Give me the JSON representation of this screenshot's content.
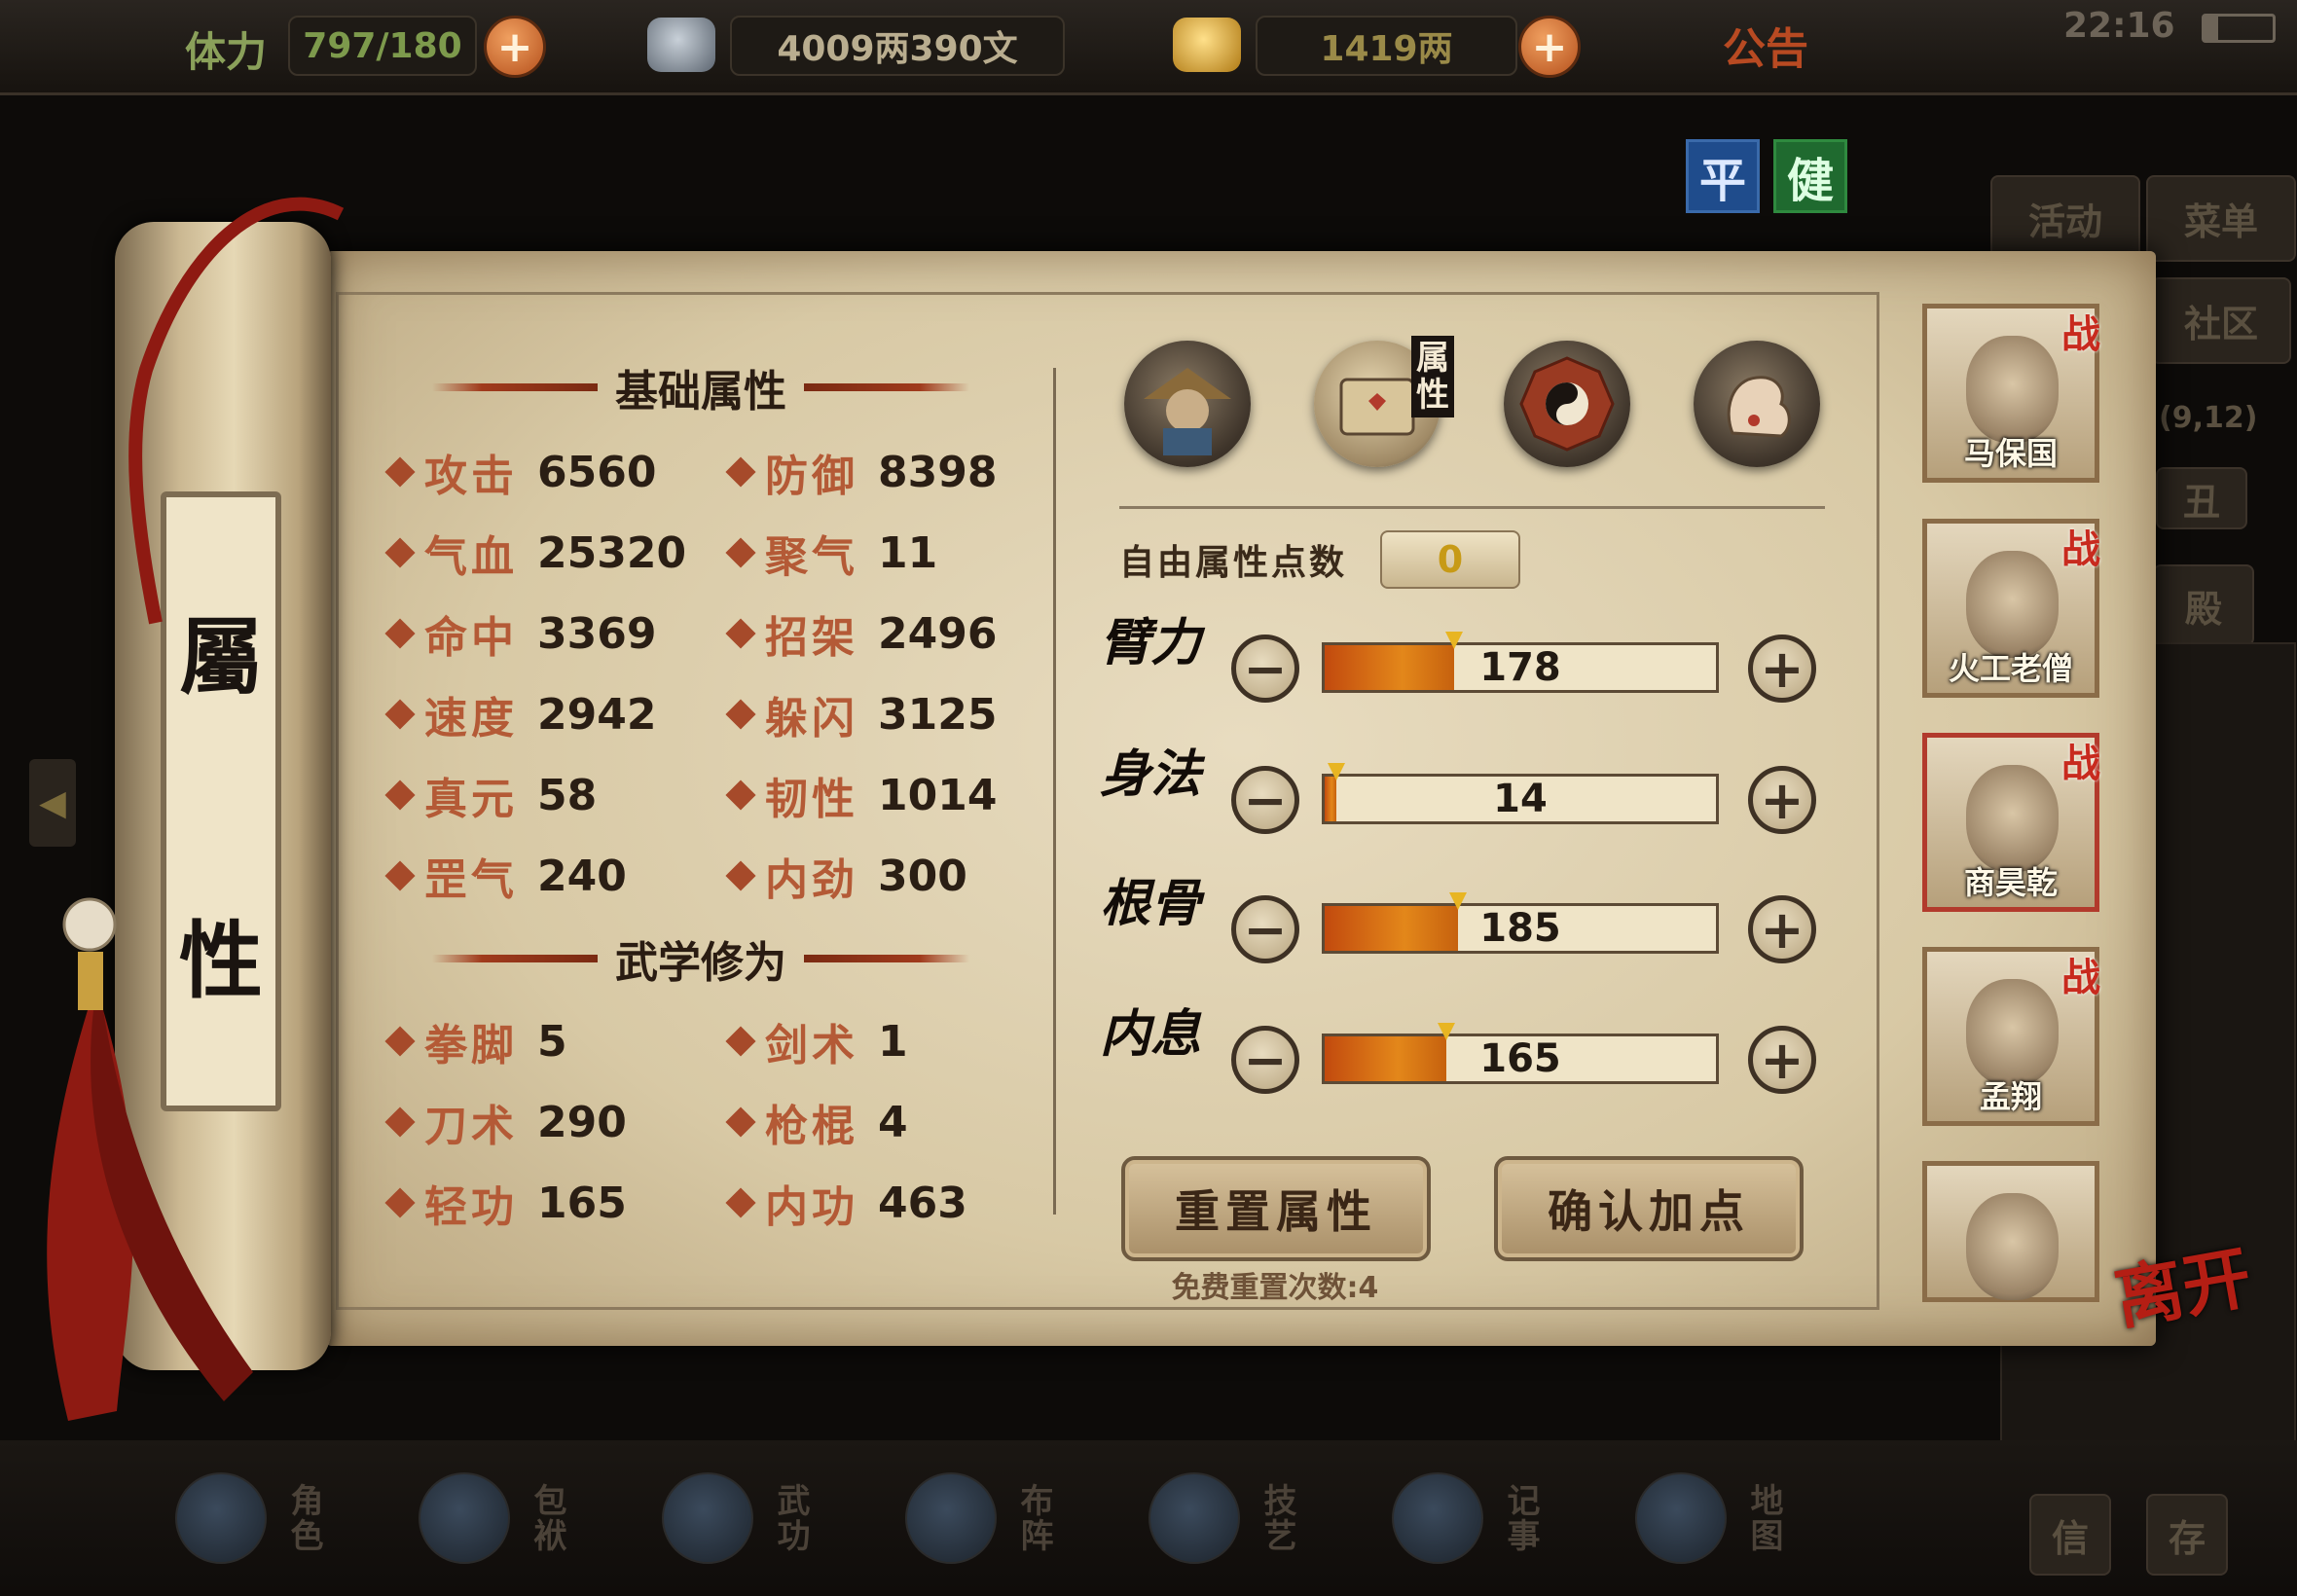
{
  "topbar": {
    "stamina_label": "体力",
    "stamina_value": "797/180",
    "silver_value": "4009两390文",
    "gold_value": "1419两",
    "notice_label": "公告",
    "time": "22:16"
  },
  "mode_buttons": [
    "平",
    "健"
  ],
  "side_buttons": {
    "activity": "活动",
    "menu": "菜单",
    "community": "社区",
    "coord": "(9,12)",
    "chou": "丑",
    "dian": "殿"
  },
  "scroll": {
    "title_top": "屬",
    "title_bottom": "性"
  },
  "basic": {
    "title": "基础属性",
    "stats": [
      {
        "name": "攻击",
        "value": "6560"
      },
      {
        "name": "防御",
        "value": "8398"
      },
      {
        "name": "气血",
        "value": "25320"
      },
      {
        "name": "聚气",
        "value": "11"
      },
      {
        "name": "命中",
        "value": "3369"
      },
      {
        "name": "招架",
        "value": "2496"
      },
      {
        "name": "速度",
        "value": "2942"
      },
      {
        "name": "躲闪",
        "value": "3125"
      },
      {
        "name": "真元",
        "value": "58"
      },
      {
        "name": "韧性",
        "value": "1014"
      },
      {
        "name": "罡气",
        "value": "240"
      },
      {
        "name": "内劲",
        "value": "300"
      }
    ]
  },
  "martial": {
    "title": "武学修为",
    "stats": [
      {
        "name": "拳脚",
        "value": "5"
      },
      {
        "name": "剑术",
        "value": "1"
      },
      {
        "name": "刀术",
        "value": "290"
      },
      {
        "name": "枪棍",
        "value": "4"
      },
      {
        "name": "轻功",
        "value": "165"
      },
      {
        "name": "内功",
        "value": "463"
      }
    ]
  },
  "tabs": {
    "attr_tab_label": "属性"
  },
  "free_points": {
    "label": "自由属性点数",
    "value": "0"
  },
  "attributes": [
    {
      "name": "臂力",
      "value": "178",
      "fill": 0.33
    },
    {
      "name": "身法",
      "value": "14",
      "fill": 0.03
    },
    {
      "name": "根骨",
      "value": "185",
      "fill": 0.34
    },
    {
      "name": "内息",
      "value": "165",
      "fill": 0.31
    }
  ],
  "buttons": {
    "reset": "重置属性",
    "confirm": "确认加点",
    "reset_note": "免费重置次数:4"
  },
  "party": [
    {
      "name": "马保国",
      "tag": "战"
    },
    {
      "name": "火工老僧",
      "tag": "战"
    },
    {
      "name": "商昊乾",
      "tag": "战"
    },
    {
      "name": "孟翔",
      "tag": "战"
    },
    {
      "name": "",
      "tag": ""
    }
  ],
  "leave_label": "离开",
  "bottom_nav": [
    "角色",
    "包袱",
    "武功",
    "布阵",
    "技艺",
    "记事",
    "地图",
    "信",
    "存"
  ],
  "colors": {
    "accent_red": "#b41e14",
    "bar_orange": "#e3871a",
    "stat_name": "#b45a36"
  }
}
